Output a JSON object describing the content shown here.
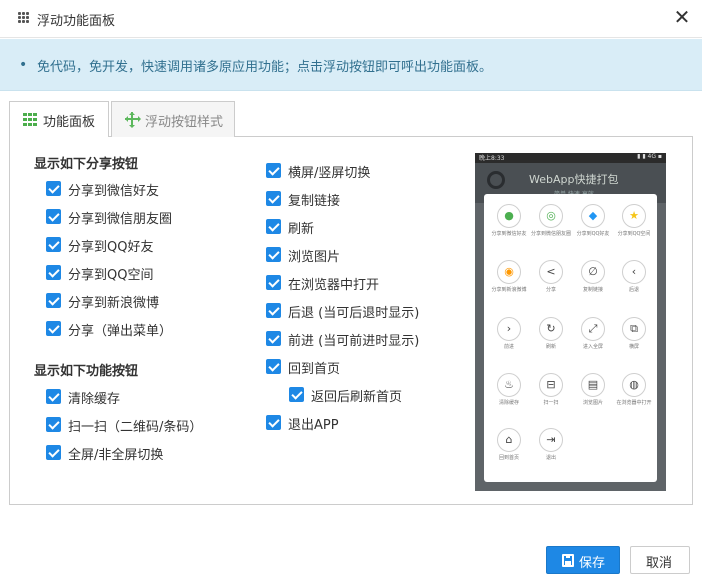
{
  "window": {
    "title": "浮动功能面板",
    "close_glyph": "✕"
  },
  "notice": {
    "bullet": "•",
    "text": "免代码，免开发，快速调用诸多原应用功能；点击浮动按钮即可呼出功能面板。"
  },
  "tabs": [
    {
      "label": "功能面板",
      "icon": "grid-icon",
      "active": true
    },
    {
      "label": "浮动按钮样式",
      "icon": "move-icon",
      "active": false
    }
  ],
  "share_section": {
    "title": "显示如下分享按钮",
    "items": [
      {
        "label": "分享到微信好友",
        "checked": true
      },
      {
        "label": "分享到微信朋友圈",
        "checked": true
      },
      {
        "label": "分享到QQ好友",
        "checked": true
      },
      {
        "label": "分享到QQ空间",
        "checked": true
      },
      {
        "label": "分享到新浪微博",
        "checked": true
      },
      {
        "label": "分享（弹出菜单）",
        "checked": true
      }
    ]
  },
  "function_section": {
    "title": "显示如下功能按钮",
    "items": [
      {
        "label": "清除缓存",
        "checked": true
      },
      {
        "label": "扫一扫（二维码/条码）",
        "checked": true
      },
      {
        "label": "全屏/非全屏切换",
        "checked": true
      }
    ]
  },
  "right_column": {
    "items": [
      {
        "label": "横屏/竖屏切换",
        "checked": true
      },
      {
        "label": "复制链接",
        "checked": true
      },
      {
        "label": "刷新",
        "checked": true
      },
      {
        "label": "浏览图片",
        "checked": true
      },
      {
        "label": "在浏览器中打开",
        "checked": true
      },
      {
        "label": "后退 (当可后退时显示)",
        "checked": true
      },
      {
        "label": "前进 (当可前进时显示)",
        "checked": true
      },
      {
        "label": "回到首页",
        "checked": true
      },
      {
        "label": "返回后刷新首页",
        "checked": true
      },
      {
        "label": "退出APP",
        "checked": true
      }
    ]
  },
  "preview": {
    "status_time": "晚上8:33",
    "status_right": "▮ ▮ 4G ▪",
    "app_title": "WebApp快捷打包",
    "app_subtitle": "简单 快速 高效",
    "items": [
      {
        "label": "分享到微信好友",
        "glyph": "●"
      },
      {
        "label": "分享到微信朋友圈",
        "glyph": "◎"
      },
      {
        "label": "分享到QQ好友",
        "glyph": "◆"
      },
      {
        "label": "分享到QQ空间",
        "glyph": "★"
      },
      {
        "label": "分享到新浪微博",
        "glyph": "◉"
      },
      {
        "label": "分享",
        "glyph": "<"
      },
      {
        "label": "复制链接",
        "glyph": "∅"
      },
      {
        "label": "后退",
        "glyph": "‹"
      },
      {
        "label": "前进",
        "glyph": "›"
      },
      {
        "label": "刷新",
        "glyph": "↻"
      },
      {
        "label": "进入全屏",
        "glyph": "⤢"
      },
      {
        "label": "横屏",
        "glyph": "⧉"
      },
      {
        "label": "清除缓存",
        "glyph": "♨"
      },
      {
        "label": "扫一扫",
        "glyph": "⊟"
      },
      {
        "label": "浏览图片",
        "glyph": "▤"
      },
      {
        "label": "在浏览器中打开",
        "glyph": "◍"
      },
      {
        "label": "回到首页",
        "glyph": "⌂"
      },
      {
        "label": "退出",
        "glyph": "⇥"
      }
    ]
  },
  "footer": {
    "save_label": "保存",
    "cancel_label": "取消"
  },
  "colors": {
    "accent": "#1e88e5",
    "notice_bg": "#d9edf7",
    "notice_text": "#31708f",
    "tab_icon_green": "#4cae4c"
  }
}
